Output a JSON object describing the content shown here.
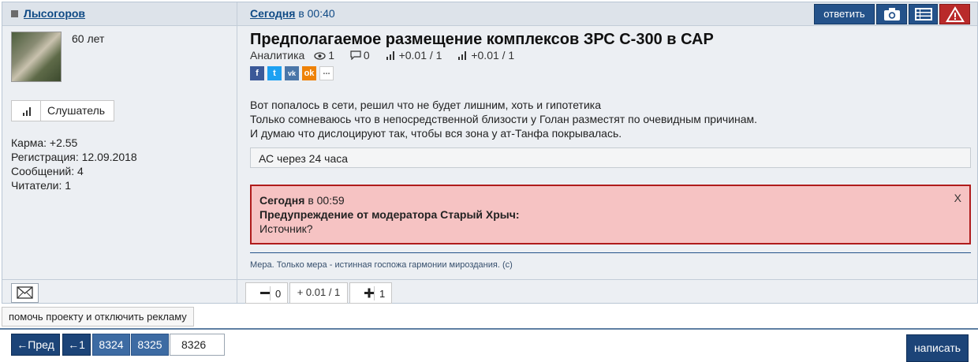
{
  "header": {
    "username": "Лысогоров",
    "time_day": "Сегодня",
    "time_rest": "в 00:40",
    "reply_label": "ответить",
    "camera_icon": "camera-icon",
    "list_icon": "list-icon",
    "warning_icon": "warning-icon"
  },
  "user": {
    "age": "60 лет",
    "listen_label": "Слушатель",
    "stats": {
      "karma": "Карма: +2.55",
      "registered": "Регистрация: 12.09.2018",
      "messages": "Сообщений: 4",
      "readers": "Читатели: 1"
    }
  },
  "post": {
    "title": "Предполагаемое размещение комплексов ЗРС С-300 в САР",
    "category": "Аналитика",
    "views": "1",
    "comments": "0",
    "rating1": "+0.01 / 1",
    "rating2": "+0.01 / 1",
    "share": [
      "f",
      "t",
      "vk",
      "ok",
      "..."
    ],
    "lines": [
      "Вот попалось в сети, решил что не будет лишним, хоть и гипотетика",
      "Только сомневаюсь что в непосредственной близости у Голан разместят по очевидным причинам.",
      "И думаю что дислоцируют так, чтобы вся зона у ат-Танфа покрывалась."
    ],
    "quote": "АС через 24 часа",
    "warning": {
      "day": "Сегодня",
      "time": "в 00:59",
      "heading": "Предупреждение от модератора Старый Хрыч:",
      "text": "Источник?",
      "close": "X"
    },
    "signature": "Мера. Только мера - истинная госпожа гармонии мироздания. (с)"
  },
  "votes": {
    "minus_count": "0",
    "score": "+ 0.01 / 1",
    "plus_count": "1"
  },
  "help_label": "помочь проекту и отключить рекламу",
  "pagination": {
    "prev": "←Пред",
    "first": "←1",
    "pages": [
      "8324",
      "8325"
    ],
    "current": "8326"
  },
  "write_label": "написать",
  "colors": {
    "accent": "#24528a",
    "link": "#0f4a85",
    "warning_bg": "#f6c3c3",
    "warning_border": "#b01c1c"
  }
}
